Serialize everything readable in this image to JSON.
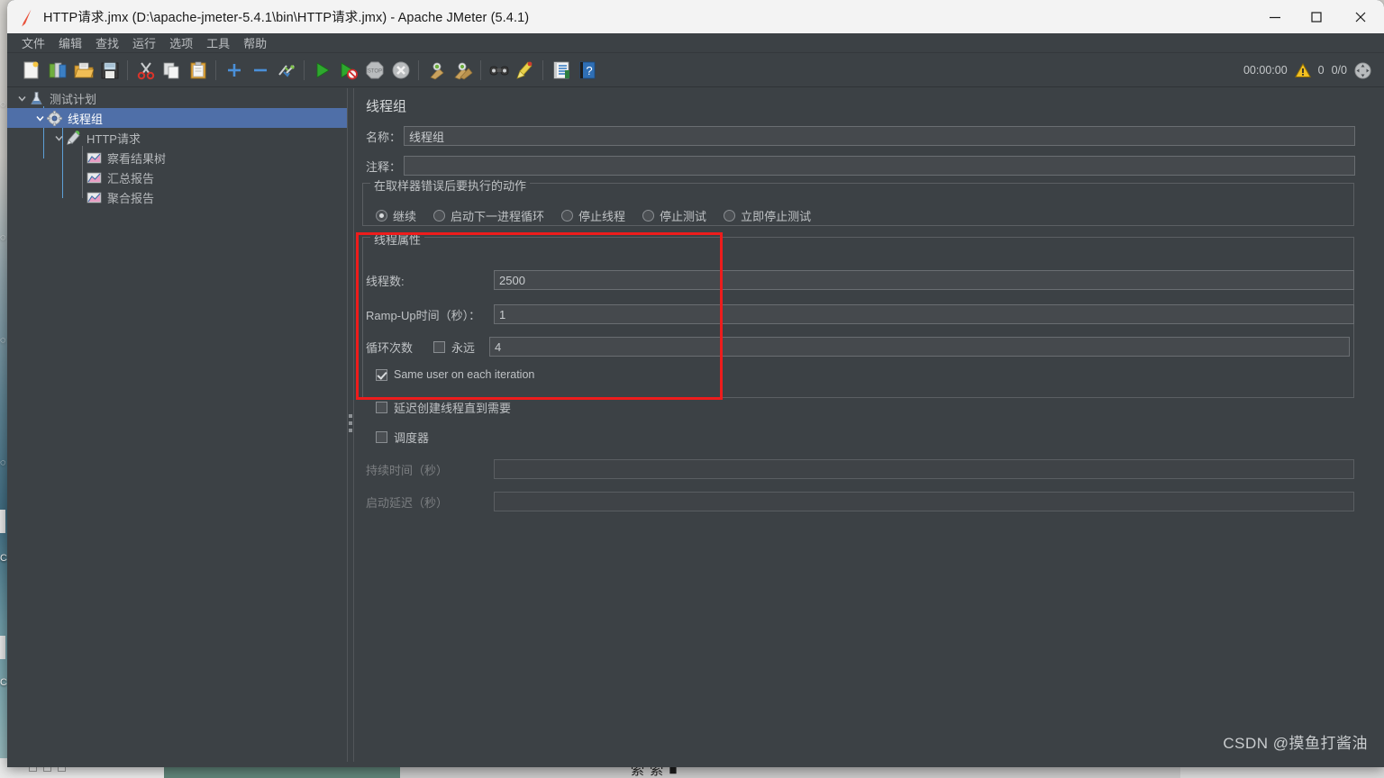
{
  "window": {
    "title": "HTTP请求.jmx (D:\\apache-jmeter-5.4.1\\bin\\HTTP请求.jmx) - Apache JMeter (5.4.1)",
    "logo_icon": "jmeter-feather-icon",
    "minimize_icon": "minimize-icon",
    "maximize_icon": "maximize-icon",
    "close_icon": "close-icon"
  },
  "menu": {
    "items": [
      {
        "label": "文件",
        "name": "menu-file"
      },
      {
        "label": "编辑",
        "name": "menu-edit"
      },
      {
        "label": "查找",
        "name": "menu-search"
      },
      {
        "label": "运行",
        "name": "menu-run"
      },
      {
        "label": "选项",
        "name": "menu-options"
      },
      {
        "label": "工具",
        "name": "menu-tools"
      },
      {
        "label": "帮助",
        "name": "menu-help"
      }
    ]
  },
  "toolbar": {
    "buttons": [
      {
        "icon": "new-document-icon",
        "name": "toolbar-new"
      },
      {
        "icon": "templates-icon",
        "name": "toolbar-templates"
      },
      {
        "icon": "open-folder-icon",
        "name": "toolbar-open"
      },
      {
        "icon": "save-floppy-icon",
        "name": "toolbar-save"
      },
      {
        "icon": "cut-scissors-icon",
        "name": "toolbar-cut"
      },
      {
        "icon": "copy-pages-icon",
        "name": "toolbar-copy"
      },
      {
        "icon": "paste-clipboard-icon",
        "name": "toolbar-paste"
      },
      {
        "icon": "plus-icon",
        "name": "toolbar-expand-all"
      },
      {
        "icon": "minus-icon",
        "name": "toolbar-collapse-all"
      },
      {
        "icon": "toggle-pencil-icon",
        "name": "toolbar-toggle"
      },
      {
        "icon": "play-green-icon",
        "name": "toolbar-start"
      },
      {
        "icon": "play-no-timers-icon",
        "name": "toolbar-start-no-pauses"
      },
      {
        "icon": "stop-sign-icon",
        "name": "toolbar-stop"
      },
      {
        "icon": "shutdown-x-icon",
        "name": "toolbar-shutdown"
      },
      {
        "icon": "clear-broom-icon",
        "name": "toolbar-clear"
      },
      {
        "icon": "clear-all-broom-icon",
        "name": "toolbar-clear-all"
      },
      {
        "icon": "binoculars-search-icon",
        "name": "toolbar-search"
      },
      {
        "icon": "reset-broom-icon",
        "name": "toolbar-reset-search"
      },
      {
        "icon": "function-helper-icon",
        "name": "toolbar-function-helper"
      },
      {
        "icon": "help-book-icon",
        "name": "toolbar-help"
      }
    ],
    "status": {
      "elapsed": "00:00:00",
      "warning_icon": "warning-triangle-icon",
      "warning_count": "0",
      "threads": "0/0",
      "activity_icon": "activity-indicator-icon"
    }
  },
  "tree": {
    "nodes": [
      {
        "label": "测试计划",
        "icon": "test-plan-icon",
        "indent": 0,
        "twisty": "expanded",
        "selected": false,
        "name": "tree-node-test-plan"
      },
      {
        "label": "线程组",
        "icon": "thread-group-gear-icon",
        "indent": 1,
        "twisty": "expanded",
        "selected": true,
        "name": "tree-node-thread-group"
      },
      {
        "label": "HTTP请求",
        "icon": "http-request-icon",
        "indent": 2,
        "twisty": "expanded",
        "selected": false,
        "name": "tree-node-http-request"
      },
      {
        "label": "察看结果树",
        "icon": "listener-chart-icon",
        "indent": 3,
        "twisty": "none",
        "selected": false,
        "name": "tree-node-view-results-tree"
      },
      {
        "label": "汇总报告",
        "icon": "listener-chart-icon",
        "indent": 3,
        "twisty": "none",
        "selected": false,
        "name": "tree-node-summary-report"
      },
      {
        "label": "聚合报告",
        "icon": "listener-chart-icon",
        "indent": 3,
        "twisty": "none",
        "selected": false,
        "name": "tree-node-aggregate-report"
      }
    ]
  },
  "panel": {
    "title": "线程组",
    "name_label": "名称：",
    "name_value": "线程组",
    "comment_label": "注释：",
    "comment_value": "",
    "action_group_title": "在取样器错误后要执行的动作",
    "actions": [
      {
        "label": "继续",
        "selected": true,
        "name": "radio-continue"
      },
      {
        "label": "启动下一进程循环",
        "selected": false,
        "name": "radio-start-next-loop"
      },
      {
        "label": "停止线程",
        "selected": false,
        "name": "radio-stop-thread"
      },
      {
        "label": "停止测试",
        "selected": false,
        "name": "radio-stop-test"
      },
      {
        "label": "立即停止测试",
        "selected": false,
        "name": "radio-stop-test-now"
      }
    ],
    "thread_props": {
      "group_title": "线程属性",
      "threads_label": "线程数:",
      "threads_value": "2500",
      "rampup_label": "Ramp-Up时间（秒）：",
      "rampup_value": "1",
      "loops_label": "循环次数",
      "forever_label": "永远",
      "forever_checked": false,
      "loops_value": "4",
      "same_user_label": "Same user on each iteration",
      "same_user_checked": true,
      "highlight_color": "#ee1c1c"
    },
    "delayed_start_label": "延迟创建线程直到需要",
    "delayed_start_checked": false,
    "scheduler_label": "调度器",
    "scheduler_checked": false,
    "duration_label": "持续时间（秒）",
    "duration_value": "",
    "startup_delay_label": "启动延迟（秒）",
    "startup_delay_value": ""
  },
  "watermark": "CSDN @摸鱼打酱油",
  "desktop": {
    "taskbar_text": "索 索 ■"
  }
}
